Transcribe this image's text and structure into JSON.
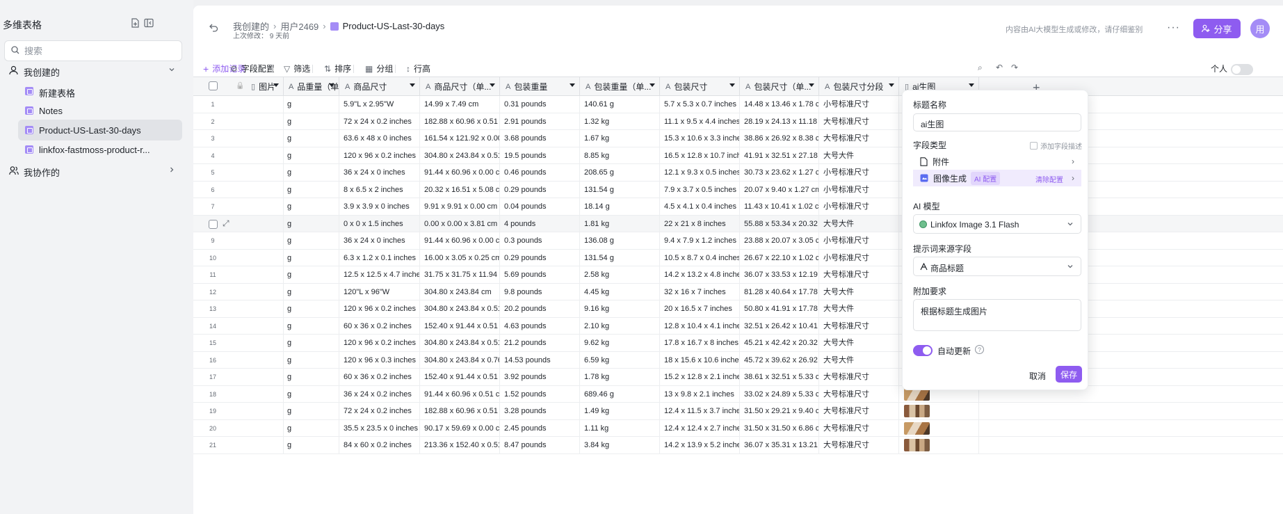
{
  "sidebar": {
    "title": "多维表格",
    "search_placeholder": "搜索",
    "created_group": "我创建的",
    "shared_group": "我协作的",
    "items": [
      {
        "label": "新建表格"
      },
      {
        "label": "Notes"
      },
      {
        "label": "Product-US-Last-30-days"
      },
      {
        "label": "linkfox-fastmoss-product-r..."
      }
    ]
  },
  "header": {
    "breadcrumb": [
      "我创建的",
      "用户2469"
    ],
    "current": "Product-US-Last-30-days",
    "modified": "上次修改： 9 天前",
    "ai_notice": "内容由AI大模型生成或修改，请仔细鉴别",
    "share_label": "分享",
    "avatar_text": "用"
  },
  "toolbar": {
    "add_record": "添加记录",
    "field_config": "字段配置",
    "filter": "筛选",
    "sort": "排序",
    "group": "分组",
    "row_height": "行高",
    "personal": "个人"
  },
  "table": {
    "columns": [
      "图片",
      "品重量（单...",
      "商品尺寸",
      "商品尺寸（单...",
      "包装重量",
      "包装重量（单...",
      "包装尺寸",
      "包装尺寸（单...",
      "包装尺寸分段",
      "ai生图"
    ],
    "rows": [
      [
        "1",
        "g",
        "5.9\"L x 2.95\"W",
        "14.99 x 7.49 cm",
        "0.31 pounds",
        "140.61 g",
        "5.7 x 5.3 x 0.7 inches",
        "14.48 x 13.46 x 1.78 cm",
        "小号标准尺寸"
      ],
      [
        "2",
        "g",
        "72 x 24 x 0.2 inches",
        "182.88 x 60.96 x 0.51 ...",
        "2.91 pounds",
        "1.32 kg",
        "11.1 x 9.5 x 4.4 inches",
        "28.19 x 24.13 x 11.18 ...",
        "大号标准尺寸"
      ],
      [
        "3",
        "g",
        "63.6 x 48 x 0 inches",
        "161.54 x 121.92 x 0.00...",
        "3.68 pounds",
        "1.67 kg",
        "15.3 x 10.6 x 3.3 inches",
        "38.86 x 26.92 x 8.38 cm",
        "大号标准尺寸"
      ],
      [
        "4",
        "g",
        "120 x 96 x 0.2 inches",
        "304.80 x 243.84 x 0.51...",
        "19.5 pounds",
        "8.85 kg",
        "16.5 x 12.8 x 10.7 inch...",
        "41.91 x 32.51 x 27.18 ...",
        "大号大件"
      ],
      [
        "5",
        "g",
        "36 x 24 x 0 inches",
        "91.44 x 60.96 x 0.00 cm",
        "0.46 pounds",
        "208.65 g",
        "12.1 x 9.3 x 0.5 inches",
        "30.73 x 23.62 x 1.27 cm",
        "小号标准尺寸"
      ],
      [
        "6",
        "g",
        "8 x 6.5 x 2 inches",
        "20.32 x 16.51 x 5.08 cm",
        "0.29 pounds",
        "131.54 g",
        "7.9 x 3.7 x 0.5 inches",
        "20.07 x 9.40 x 1.27 cm",
        "小号标准尺寸"
      ],
      [
        "7",
        "g",
        "3.9 x 3.9 x 0 inches",
        "9.91 x 9.91 x 0.00 cm",
        "0.04 pounds",
        "18.14 g",
        "4.5 x 4.1 x 0.4 inches",
        "11.43 x 10.41 x 1.02 cm",
        "小号标准尺寸"
      ],
      [
        "8",
        "g",
        "0 x 0 x 1.5 inches",
        "0.00 x 0.00 x 3.81 cm",
        "4 pounds",
        "1.81 kg",
        "22 x 21 x 8 inches",
        "55.88 x 53.34 x 20.32 ...",
        "大号大件"
      ],
      [
        "9",
        "g",
        "36 x 24 x 0 inches",
        "91.44 x 60.96 x 0.00 cm",
        "0.3 pounds",
        "136.08 g",
        "9.4 x 7.9 x 1.2 inches",
        "23.88 x 20.07 x 3.05 cm",
        "小号标准尺寸"
      ],
      [
        "10",
        "g",
        "6.3 x 1.2 x 0.1 inches",
        "16.00 x 3.05 x 0.25 cm",
        "0.29 pounds",
        "131.54 g",
        "10.5 x 8.7 x 0.4 inches",
        "26.67 x 22.10 x 1.02 cm",
        "小号标准尺寸"
      ],
      [
        "11",
        "g",
        "12.5 x 12.5 x 4.7 inches",
        "31.75 x 31.75 x 11.94 ...",
        "5.69 pounds",
        "2.58 kg",
        "14.2 x 13.2 x 4.8 inches",
        "36.07 x 33.53 x 12.19 ...",
        "大号标准尺寸"
      ],
      [
        "12",
        "g",
        "120\"L x 96\"W",
        "304.80 x 243.84 cm",
        "9.8 pounds",
        "4.45 kg",
        "32 x 16 x 7 inches",
        "81.28 x 40.64 x 17.78 ...",
        "大号大件"
      ],
      [
        "13",
        "g",
        "120 x 96 x 0.2 inches",
        "304.80 x 243.84 x 0.51...",
        "20.2 pounds",
        "9.16 kg",
        "20 x 16.5 x 7 inches",
        "50.80 x 41.91 x 17.78 ...",
        "大号大件"
      ],
      [
        "14",
        "g",
        "60 x 36 x 0.2 inches",
        "152.40 x 91.44 x 0.51 ...",
        "4.63 pounds",
        "2.10 kg",
        "12.8 x 10.4 x 4.1 inches",
        "32.51 x 26.42 x 10.41 ...",
        "大号标准尺寸"
      ],
      [
        "15",
        "g",
        "120 x 96 x 0.2 inches",
        "304.80 x 243.84 x 0.51...",
        "21.2 pounds",
        "9.62 kg",
        "17.8 x 16.7 x 8 inches",
        "45.21 x 42.42 x 20.32 ...",
        "大号大件"
      ],
      [
        "16",
        "g",
        "120 x 96 x 0.3 inches",
        "304.80 x 243.84 x 0.76...",
        "14.53 pounds",
        "6.59 kg",
        "18 x 15.6 x 10.6 inches",
        "45.72 x 39.62 x 26.92 ...",
        "大号大件"
      ],
      [
        "17",
        "g",
        "60 x 36 x 0.2 inches",
        "152.40 x 91.44 x 0.51 ...",
        "3.92 pounds",
        "1.78 kg",
        "15.2 x 12.8 x 2.1 inches",
        "38.61 x 32.51 x 5.33 cm",
        "大号标准尺寸"
      ],
      [
        "18",
        "g",
        "36 x 24 x 0.2 inches",
        "91.44 x 60.96 x 0.51 cm",
        "1.52 pounds",
        "689.46 g",
        "13 x 9.8 x 2.1 inches",
        "33.02 x 24.89 x 5.33 cm",
        "大号标准尺寸"
      ],
      [
        "19",
        "g",
        "72 x 24 x 0.2 inches",
        "182.88 x 60.96 x 0.51 ...",
        "3.28 pounds",
        "1.49 kg",
        "12.4 x 11.5 x 3.7 inches",
        "31.50 x 29.21 x 9.40 cm",
        "大号标准尺寸"
      ],
      [
        "20",
        "g",
        "35.5 x 23.5 x 0 inches",
        "90.17 x 59.69 x 0.00 cm",
        "2.45 pounds",
        "1.11 kg",
        "12.4 x 12.4 x 2.7 inches",
        "31.50 x 31.50 x 6.86 cm",
        "大号标准尺寸"
      ],
      [
        "21",
        "g",
        "84 x 60 x 0.2 inches",
        "213.36 x 152.40 x 0.51 ...",
        "8.47 pounds",
        "3.84 kg",
        "14.2 x 13.9 x 5.2 inches",
        "36.07 x 35.31 x 13.21 ...",
        "大号标准尺寸"
      ]
    ]
  },
  "panel": {
    "title_label": "标题名称",
    "title_value": "ai生图",
    "field_type_label": "字段类型",
    "add_desc": "添加字段描述",
    "attachment": "附件",
    "image_gen": "图像生成",
    "ai_config": "AI 配置",
    "clear_config": "清除配置",
    "model_label": "AI 模型",
    "model_value": "Linkfox Image 3.1 Flash",
    "prompt_label": "提示词来源字段",
    "prompt_value": "商品标题",
    "extra_label": "附加要求",
    "extra_value": "根据标题生成图片",
    "auto_update": "自动更新",
    "cancel": "取消",
    "save": "保存"
  }
}
